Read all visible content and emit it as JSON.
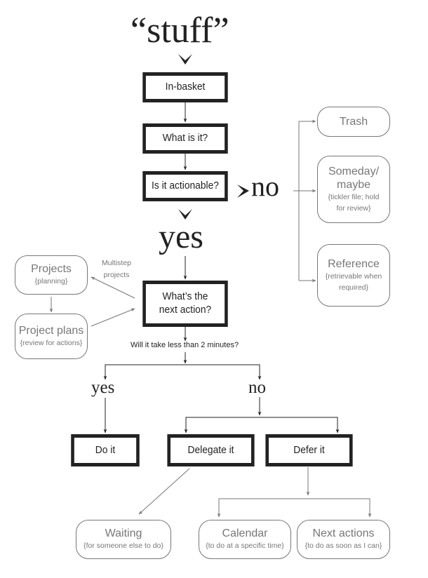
{
  "title": "“stuff”",
  "colors": {
    "primary_stroke": "#222222",
    "secondary_stroke": "#777777",
    "background": "#ffffff"
  },
  "decision_boxes": {
    "in_basket": "In-basket",
    "what_is_it": "What is it?",
    "is_actionable": "Is it actionable?",
    "next_action": "What’s the next action?",
    "do_it": "Do it",
    "delegate_it": "Delegate it",
    "defer_it": "Defer it"
  },
  "branch_labels": {
    "actionable_no": "no",
    "actionable_yes": "yes",
    "two_min_question": "Will it take less than 2 minutes?",
    "two_min_yes": "yes",
    "two_min_no": "no",
    "multistep": "Multistep projects"
  },
  "outcomes": {
    "trash": {
      "title": "Trash",
      "sub": ""
    },
    "someday": {
      "title": "Someday/ maybe",
      "sub": "{tickler file; hold for review}"
    },
    "reference": {
      "title": "Reference",
      "sub": "{retrievable when required}"
    },
    "projects": {
      "title": "Projects",
      "sub": "{planning}"
    },
    "project_plans": {
      "title": "Project plans",
      "sub": "{review for actions}"
    },
    "waiting": {
      "title": "Waiting",
      "sub": "{for someone else to do}"
    },
    "calendar": {
      "title": "Calendar",
      "sub": "{to do at a specific time}"
    },
    "next_actions": {
      "title": "Next actions",
      "sub": "{to do as soon as I can}"
    }
  }
}
